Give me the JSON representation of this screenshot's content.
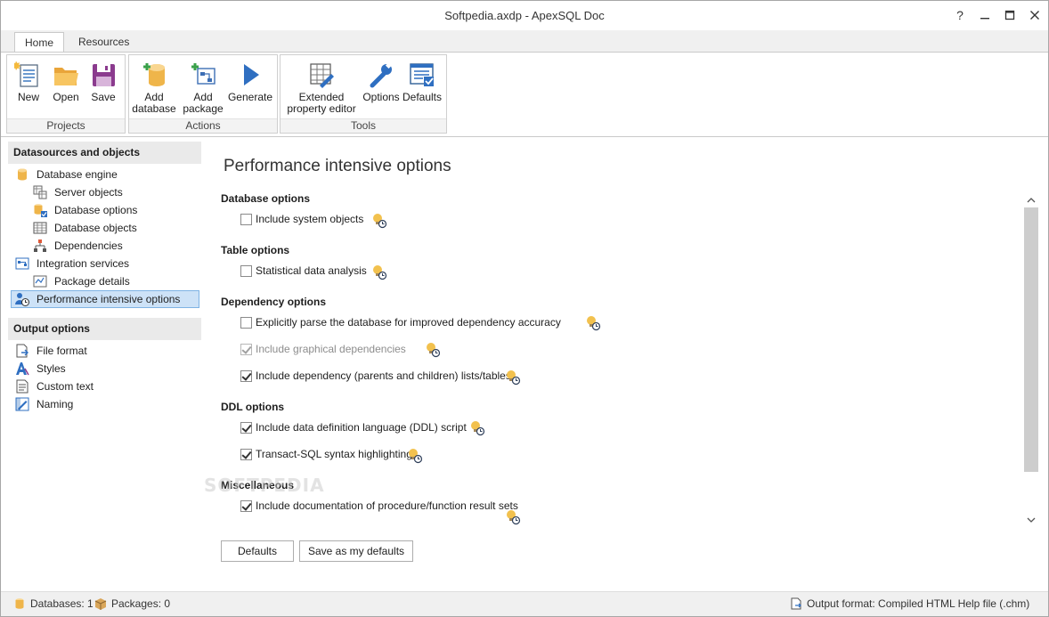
{
  "window": {
    "title": "Softpedia.axdp - ApexSQL Doc",
    "help": "?",
    "minimize": "—",
    "maximize": "☐",
    "close": "✕"
  },
  "ribbon_tabs": [
    "Home",
    "Resources"
  ],
  "ribbon": {
    "projects": {
      "label": "Projects",
      "new": "New",
      "open": "Open",
      "save": "Save"
    },
    "actions": {
      "label": "Actions",
      "add_database": [
        "Add",
        "database"
      ],
      "add_package": [
        "Add",
        "package"
      ],
      "generate": "Generate"
    },
    "tools": {
      "label": "Tools",
      "extended_property_editor": [
        "Extended",
        "property editor"
      ],
      "options": "Options",
      "defaults": "Defaults"
    }
  },
  "sidebar": {
    "datasources_header": "Datasources and objects",
    "datasources_items": [
      {
        "label": "Database engine",
        "icon": "database-icon"
      },
      {
        "label": "Server objects",
        "icon": "server-objects-icon"
      },
      {
        "label": "Database options",
        "icon": "database-options-icon"
      },
      {
        "label": "Database objects",
        "icon": "table-grid-icon"
      },
      {
        "label": "Dependencies",
        "icon": "dependencies-icon"
      },
      {
        "label": "Integration services",
        "icon": "integration-services-icon"
      },
      {
        "label": "Package details",
        "icon": "package-details-icon"
      },
      {
        "label": "Performance intensive options",
        "icon": "performance-icon"
      }
    ],
    "output_header": "Output options",
    "output_items": [
      {
        "label": "File format",
        "icon": "file-format-icon"
      },
      {
        "label": "Styles",
        "icon": "styles-icon"
      },
      {
        "label": "Custom text",
        "icon": "custom-text-icon"
      },
      {
        "label": "Naming",
        "icon": "naming-icon"
      }
    ]
  },
  "main": {
    "title": "Performance intensive options",
    "sections": [
      {
        "header": "Database options",
        "options": [
          {
            "label": "Include system objects",
            "checked": false,
            "disabled": false
          }
        ]
      },
      {
        "header": "Table options",
        "options": [
          {
            "label": "Statistical data analysis",
            "checked": false,
            "disabled": false
          }
        ]
      },
      {
        "header": "Dependency options",
        "options": [
          {
            "label": "Explicitly parse the database for improved dependency accuracy",
            "checked": false,
            "disabled": false
          },
          {
            "label": "Include graphical dependencies",
            "checked": true,
            "disabled": true
          },
          {
            "label": "Include dependency (parents and children) lists/tables",
            "checked": true,
            "disabled": false
          }
        ]
      },
      {
        "header": "DDL options",
        "options": [
          {
            "label": "Include data definition language (DDL) script",
            "checked": true,
            "disabled": false
          },
          {
            "label": "Transact-SQL syntax highlighting",
            "checked": true,
            "disabled": false
          }
        ]
      },
      {
        "header": "Miscellaneous",
        "options": [
          {
            "label": "Include documentation of procedure/function result sets",
            "checked": true,
            "disabled": false
          }
        ]
      }
    ],
    "defaults_button": "Defaults",
    "save_defaults_button": "Save as my defaults",
    "watermark": "SOFTPEDIA"
  },
  "status": {
    "databases": "Databases: 1",
    "packages": "Packages: 0",
    "output_format": "Output format: Compiled HTML Help file (.chm)"
  }
}
